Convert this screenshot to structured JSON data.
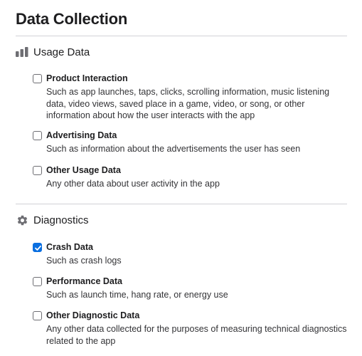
{
  "page": {
    "title": "Data Collection"
  },
  "sections": [
    {
      "title": "Usage Data",
      "icon": "bar-chart-icon",
      "options": [
        {
          "title": "Product Interaction",
          "description": "Such as app launches, taps, clicks, scrolling information, music listening data, video views, saved place in a game, video, or song, or other information about how the user interacts with the app",
          "checked": false
        },
        {
          "title": "Advertising Data",
          "description": "Such as information about the advertisements the user has seen",
          "checked": false
        },
        {
          "title": "Other Usage Data",
          "description": "Any other data about user activity in the app",
          "checked": false
        }
      ]
    },
    {
      "title": "Diagnostics",
      "icon": "gear-icon",
      "options": [
        {
          "title": "Crash Data",
          "description": "Such as crash logs",
          "checked": true
        },
        {
          "title": "Performance Data",
          "description": "Such as launch time, hang rate, or energy use",
          "checked": false
        },
        {
          "title": "Other Diagnostic Data",
          "description": "Any other data collected for the purposes of measuring technical diagnostics related to the app",
          "checked": false
        }
      ]
    }
  ],
  "colors": {
    "accent": "#0a6fe0",
    "text": "#1d1d1f",
    "divider": "#d2d2d7",
    "icon": "#6e6e73"
  }
}
